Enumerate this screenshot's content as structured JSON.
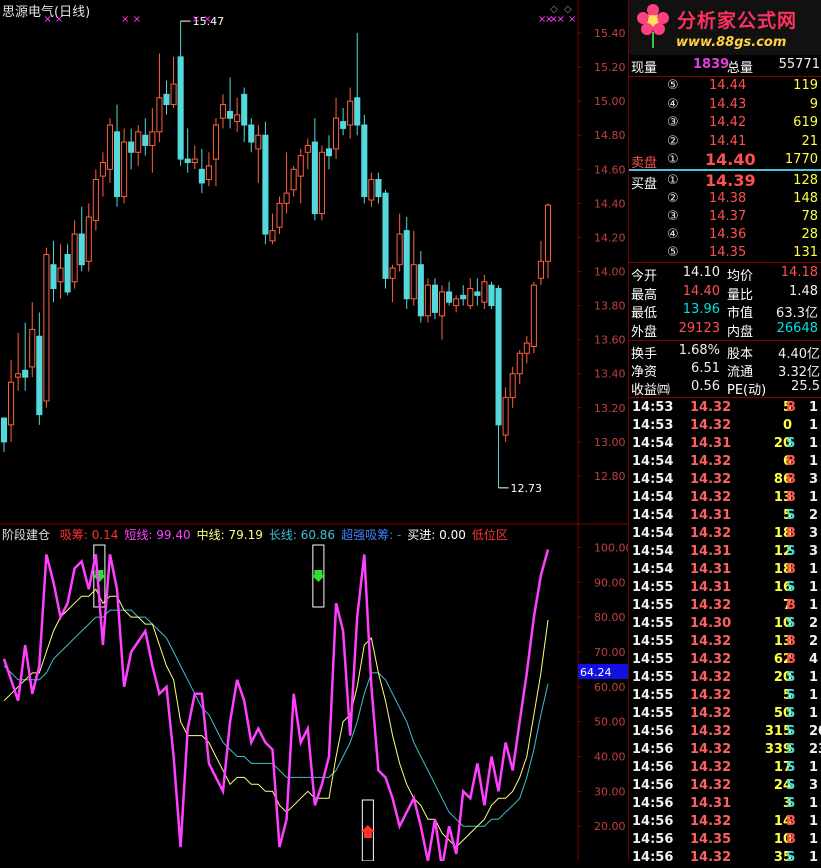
{
  "title": {
    "stock_name": "思源电气",
    "period": "(日线)"
  },
  "colors": {
    "up": "#ff6040",
    "up_body_fill": "#000000",
    "down": "#54d8dc",
    "grid": "#800000",
    "axis_text": "#c04040",
    "magenta": "#ff40ff",
    "yellow": "#ffff80",
    "cyan": "#40c0d0",
    "highlight_box": "#ffffff"
  },
  "chart_data": [
    {
      "type": "candlestick",
      "title": "思源电气(日线)",
      "ylim": [
        12.6,
        15.5
      ],
      "y_ticks": [
        "15.40",
        "15.20",
        "15.00",
        "14.80",
        "14.60",
        "14.40",
        "14.20",
        "14.00",
        "13.80",
        "13.60",
        "13.40",
        "13.20",
        "13.00",
        "12.80"
      ],
      "annotations": [
        {
          "label": "15.47",
          "kind": "high",
          "candle_index": 25
        },
        {
          "label": "12.73",
          "kind": "low",
          "candle_index": 70
        }
      ],
      "marker_rows": [
        {
          "label": "× ×",
          "candle_index": 5
        },
        {
          "label": "× ×",
          "candle_index": 16
        },
        {
          "label": "× ×",
          "candle_index": 26
        },
        {
          "label": "× ×",
          "candle_index": 75
        },
        {
          "label": "× × ×",
          "candle_index": 76
        }
      ],
      "corner_marks": [
        "◇",
        "◇"
      ],
      "candles": [
        {
          "o": 13.14,
          "h": 13.14,
          "l": 12.94,
          "c": 13.0
        },
        {
          "o": 13.1,
          "h": 13.48,
          "l": 13.0,
          "c": 13.35
        },
        {
          "o": 13.38,
          "h": 13.64,
          "l": 13.3,
          "c": 13.4
        },
        {
          "o": 13.42,
          "h": 13.7,
          "l": 13.3,
          "c": 13.38
        },
        {
          "o": 13.44,
          "h": 13.82,
          "l": 13.38,
          "c": 13.66
        },
        {
          "o": 13.62,
          "h": 13.76,
          "l": 13.1,
          "c": 13.16
        },
        {
          "o": 13.24,
          "h": 14.14,
          "l": 13.2,
          "c": 14.1
        },
        {
          "o": 14.04,
          "h": 14.18,
          "l": 13.82,
          "c": 13.9
        },
        {
          "o": 13.94,
          "h": 14.16,
          "l": 13.84,
          "c": 14.02
        },
        {
          "o": 14.1,
          "h": 14.16,
          "l": 13.86,
          "c": 13.88
        },
        {
          "o": 13.94,
          "h": 14.3,
          "l": 13.9,
          "c": 14.22
        },
        {
          "o": 14.22,
          "h": 14.38,
          "l": 14.0,
          "c": 14.04
        },
        {
          "o": 14.06,
          "h": 14.4,
          "l": 14.0,
          "c": 14.32
        },
        {
          "o": 14.3,
          "h": 14.6,
          "l": 14.24,
          "c": 14.54
        },
        {
          "o": 14.56,
          "h": 14.7,
          "l": 14.44,
          "c": 14.64
        },
        {
          "o": 14.6,
          "h": 14.9,
          "l": 14.52,
          "c": 14.86
        },
        {
          "o": 14.82,
          "h": 14.98,
          "l": 14.38,
          "c": 14.44
        },
        {
          "o": 14.44,
          "h": 14.84,
          "l": 14.4,
          "c": 14.76
        },
        {
          "o": 14.76,
          "h": 14.84,
          "l": 14.6,
          "c": 14.7
        },
        {
          "o": 14.7,
          "h": 14.86,
          "l": 14.62,
          "c": 14.82
        },
        {
          "o": 14.8,
          "h": 14.9,
          "l": 14.68,
          "c": 14.74
        },
        {
          "o": 14.74,
          "h": 14.96,
          "l": 14.58,
          "c": 14.82
        },
        {
          "o": 14.82,
          "h": 15.28,
          "l": 14.76,
          "c": 15.02
        },
        {
          "o": 15.04,
          "h": 15.12,
          "l": 14.92,
          "c": 14.98
        },
        {
          "o": 14.98,
          "h": 15.26,
          "l": 14.96,
          "c": 15.1
        },
        {
          "o": 15.26,
          "h": 15.47,
          "l": 14.62,
          "c": 14.66
        },
        {
          "o": 14.66,
          "h": 14.84,
          "l": 14.58,
          "c": 14.64
        },
        {
          "o": 14.64,
          "h": 14.74,
          "l": 14.6,
          "c": 14.66
        },
        {
          "o": 14.6,
          "h": 14.72,
          "l": 14.46,
          "c": 14.52
        },
        {
          "o": 14.54,
          "h": 14.7,
          "l": 14.5,
          "c": 14.62
        },
        {
          "o": 14.66,
          "h": 14.9,
          "l": 14.5,
          "c": 14.86
        },
        {
          "o": 14.9,
          "h": 15.04,
          "l": 14.84,
          "c": 14.98
        },
        {
          "o": 14.94,
          "h": 15.14,
          "l": 14.84,
          "c": 14.9
        },
        {
          "o": 14.88,
          "h": 15.02,
          "l": 14.82,
          "c": 14.92
        },
        {
          "o": 15.04,
          "h": 15.08,
          "l": 14.76,
          "c": 14.86
        },
        {
          "o": 14.86,
          "h": 14.9,
          "l": 14.7,
          "c": 14.76
        },
        {
          "o": 14.72,
          "h": 14.86,
          "l": 14.52,
          "c": 14.8
        },
        {
          "o": 14.8,
          "h": 14.88,
          "l": 14.16,
          "c": 14.22
        },
        {
          "o": 14.18,
          "h": 14.34,
          "l": 14.16,
          "c": 14.24
        },
        {
          "o": 14.26,
          "h": 14.44,
          "l": 14.22,
          "c": 14.4
        },
        {
          "o": 14.4,
          "h": 14.7,
          "l": 14.34,
          "c": 14.46
        },
        {
          "o": 14.48,
          "h": 14.62,
          "l": 14.44,
          "c": 14.6
        },
        {
          "o": 14.56,
          "h": 14.72,
          "l": 14.4,
          "c": 14.68
        },
        {
          "o": 14.7,
          "h": 14.78,
          "l": 14.6,
          "c": 14.74
        },
        {
          "o": 14.76,
          "h": 14.9,
          "l": 14.3,
          "c": 14.34
        },
        {
          "o": 14.34,
          "h": 14.74,
          "l": 14.3,
          "c": 14.7
        },
        {
          "o": 14.72,
          "h": 14.8,
          "l": 14.6,
          "c": 14.68
        },
        {
          "o": 14.72,
          "h": 15.02,
          "l": 14.66,
          "c": 14.9
        },
        {
          "o": 14.88,
          "h": 14.96,
          "l": 14.8,
          "c": 14.84
        },
        {
          "o": 14.86,
          "h": 15.08,
          "l": 14.78,
          "c": 15.0
        },
        {
          "o": 15.02,
          "h": 15.4,
          "l": 14.8,
          "c": 14.86
        },
        {
          "o": 14.86,
          "h": 14.92,
          "l": 14.4,
          "c": 14.44
        },
        {
          "o": 14.42,
          "h": 14.58,
          "l": 14.38,
          "c": 14.54
        },
        {
          "o": 14.54,
          "h": 14.58,
          "l": 14.4,
          "c": 14.44
        },
        {
          "o": 14.46,
          "h": 14.48,
          "l": 13.9,
          "c": 13.96
        },
        {
          "o": 13.96,
          "h": 14.04,
          "l": 13.82,
          "c": 14.02
        },
        {
          "o": 14.04,
          "h": 14.34,
          "l": 14.0,
          "c": 14.22
        },
        {
          "o": 14.24,
          "h": 14.32,
          "l": 13.78,
          "c": 13.84
        },
        {
          "o": 13.84,
          "h": 14.24,
          "l": 13.8,
          "c": 14.04
        },
        {
          "o": 14.04,
          "h": 14.12,
          "l": 13.7,
          "c": 13.74
        },
        {
          "o": 13.74,
          "h": 13.96,
          "l": 13.7,
          "c": 13.92
        },
        {
          "o": 13.92,
          "h": 13.96,
          "l": 13.72,
          "c": 13.76
        },
        {
          "o": 13.74,
          "h": 13.92,
          "l": 13.6,
          "c": 13.88
        },
        {
          "o": 13.88,
          "h": 13.94,
          "l": 13.8,
          "c": 13.82
        },
        {
          "o": 13.8,
          "h": 13.86,
          "l": 13.76,
          "c": 13.84
        },
        {
          "o": 13.86,
          "h": 13.92,
          "l": 13.8,
          "c": 13.84
        },
        {
          "o": 13.8,
          "h": 13.96,
          "l": 13.78,
          "c": 13.9
        },
        {
          "o": 13.88,
          "h": 13.96,
          "l": 13.8,
          "c": 13.86
        },
        {
          "o": 13.82,
          "h": 13.98,
          "l": 13.78,
          "c": 13.94
        },
        {
          "o": 13.92,
          "h": 13.94,
          "l": 13.78,
          "c": 13.8
        },
        {
          "o": 13.9,
          "h": 13.92,
          "l": 12.73,
          "c": 13.1
        },
        {
          "o": 13.04,
          "h": 13.32,
          "l": 13.0,
          "c": 13.26
        },
        {
          "o": 13.26,
          "h": 13.44,
          "l": 13.2,
          "c": 13.4
        },
        {
          "o": 13.4,
          "h": 13.54,
          "l": 13.34,
          "c": 13.52
        },
        {
          "o": 13.52,
          "h": 13.62,
          "l": 13.46,
          "c": 13.58
        },
        {
          "o": 13.56,
          "h": 13.94,
          "l": 13.52,
          "c": 13.92
        },
        {
          "o": 13.96,
          "h": 14.18,
          "l": 13.92,
          "c": 14.06
        },
        {
          "o": 14.06,
          "h": 14.4,
          "l": 13.96,
          "c": 14.39
        }
      ]
    },
    {
      "type": "line",
      "title": "阶段建仓",
      "ylim": [
        10,
        105
      ],
      "y_ticks": [
        "100.00",
        "90.00",
        "80.00",
        "70.00",
        "60.00",
        "50.00",
        "40.00",
        "30.00",
        "20.00"
      ],
      "current_value_label": "64.24",
      "legend": [
        {
          "name": "吸筹",
          "value": "0.14",
          "color": "#ff3030"
        },
        {
          "name": "短线",
          "value": "99.40",
          "color": "#ff40ff"
        },
        {
          "name": "中线",
          "value": "79.19",
          "color": "#ffff80"
        },
        {
          "name": "长线",
          "value": "60.86",
          "color": "#40c0d0"
        },
        {
          "name": "超强吸筹",
          "value": "-",
          "color": "#4080ff"
        },
        {
          "name": "买进",
          "value": "0.00",
          "color": "#ffffff"
        },
        {
          "name": "低位区",
          "value": "",
          "color": "#ff3030"
        }
      ],
      "series": [
        {
          "name": "短线",
          "color": "#ff40ff",
          "values": [
            68,
            62,
            56,
            72,
            58,
            66,
            98,
            90,
            80,
            84,
            94,
            96,
            88,
            98,
            72,
            98,
            88,
            60,
            70,
            73,
            76,
            66,
            58,
            60,
            40,
            14,
            48,
            58,
            58,
            38,
            34,
            30,
            50,
            62,
            56,
            44,
            48,
            44,
            42,
            14,
            22,
            58,
            44,
            48,
            26,
            32,
            40,
            84,
            76,
            46,
            80,
            98,
            60,
            36,
            34,
            28,
            20,
            24,
            28,
            20,
            10,
            22,
            8,
            20,
            12,
            30,
            28,
            38,
            26,
            40,
            30,
            44,
            36,
            50,
            64,
            80,
            92,
            99.4
          ]
        },
        {
          "name": "中线",
          "color": "#ffff80",
          "values": [
            56,
            58,
            60,
            62,
            64,
            64,
            70,
            76,
            80,
            82,
            84,
            86,
            86,
            88,
            84,
            86,
            86,
            82,
            80,
            80,
            78,
            78,
            72,
            66,
            62,
            50,
            46,
            46,
            46,
            44,
            40,
            36,
            32,
            34,
            34,
            32,
            32,
            30,
            30,
            26,
            24,
            26,
            28,
            30,
            28,
            28,
            28,
            40,
            50,
            52,
            60,
            72,
            74,
            64,
            56,
            46,
            38,
            32,
            28,
            26,
            22,
            22,
            18,
            16,
            14,
            16,
            18,
            20,
            22,
            26,
            28,
            28,
            30,
            34,
            40,
            52,
            64,
            79.2
          ]
        },
        {
          "name": "长线",
          "color": "#40c0d0",
          "values": [
            66,
            64,
            62,
            62,
            62,
            62,
            64,
            68,
            70,
            72,
            74,
            76,
            78,
            80,
            80,
            82,
            82,
            82,
            82,
            80,
            80,
            78,
            76,
            74,
            70,
            66,
            62,
            58,
            54,
            52,
            48,
            44,
            42,
            40,
            40,
            38,
            38,
            38,
            38,
            36,
            34,
            34,
            34,
            34,
            34,
            34,
            34,
            36,
            40,
            44,
            50,
            58,
            64,
            64,
            62,
            58,
            54,
            50,
            44,
            40,
            36,
            32,
            28,
            24,
            22,
            20,
            20,
            20,
            20,
            22,
            22,
            24,
            26,
            28,
            34,
            42,
            52,
            60.9
          ]
        }
      ],
      "signal_boxes": [
        {
          "start_index": 13,
          "end_index": 14,
          "arrow": "down"
        },
        {
          "start_index": 44,
          "end_index": 45,
          "arrow": "down"
        },
        {
          "start_index": 51,
          "end_index": 52,
          "arrow": "up"
        }
      ]
    }
  ],
  "quote": {
    "labels": {
      "current_vol": "现量",
      "total_vol": "总量",
      "sell_panel": "卖盘",
      "buy_panel": "买盘",
      "today_open": "今开",
      "avg_price": "均价",
      "high": "最高",
      "vol_ratio": "量比",
      "low": "最低",
      "market_cap": "市值",
      "outer": "外盘",
      "inner": "内盘",
      "turnover": "换手",
      "share_capital": "股本",
      "net_asset": "净资",
      "float": "流通",
      "eps": "收益㈣",
      "pe": "PE(动)"
    },
    "current_vol": "1839",
    "total_vol": "55771",
    "asks": [
      {
        "lvl": "⑤",
        "price": "14.44",
        "vol": "119"
      },
      {
        "lvl": "④",
        "price": "14.43",
        "vol": "9"
      },
      {
        "lvl": "③",
        "price": "14.42",
        "vol": "619"
      },
      {
        "lvl": "②",
        "price": "14.41",
        "vol": "21"
      },
      {
        "lvl": "①",
        "price": "14.40",
        "vol": "1770"
      }
    ],
    "bids": [
      {
        "lvl": "①",
        "price": "14.39",
        "vol": "128"
      },
      {
        "lvl": "②",
        "price": "14.38",
        "vol": "148"
      },
      {
        "lvl": "③",
        "price": "14.37",
        "vol": "78"
      },
      {
        "lvl": "④",
        "price": "14.36",
        "vol": "28"
      },
      {
        "lvl": "⑤",
        "price": "14.35",
        "vol": "131"
      }
    ],
    "today_open": "14.10",
    "avg_price": "14.18",
    "high": "14.40",
    "vol_ratio": "1.48",
    "low": "13.96",
    "market_cap": "63.3亿",
    "outer": "29123",
    "inner": "26648",
    "turnover": "1.68%",
    "share_capital": "4.40亿",
    "net_asset": "6.51",
    "float": "3.32亿",
    "eps": "0.56",
    "pe": "25.5"
  },
  "trades": [
    {
      "t": "14:53",
      "p": "14.32",
      "v": "5",
      "bs": "B",
      "n": "1"
    },
    {
      "t": "14:53",
      "p": "14.32",
      "v": "0",
      "bs": "",
      "n": "1"
    },
    {
      "t": "14:54",
      "p": "14.31",
      "v": "20",
      "bs": "S",
      "n": "1"
    },
    {
      "t": "14:54",
      "p": "14.32",
      "v": "6",
      "bs": "B",
      "n": "1"
    },
    {
      "t": "14:54",
      "p": "14.32",
      "v": "86",
      "bs": "B",
      "n": "3"
    },
    {
      "t": "14:54",
      "p": "14.32",
      "v": "13",
      "bs": "B",
      "n": "1"
    },
    {
      "t": "14:54",
      "p": "14.31",
      "v": "5",
      "bs": "S",
      "n": "2"
    },
    {
      "t": "14:54",
      "p": "14.32",
      "v": "18",
      "bs": "B",
      "n": "3"
    },
    {
      "t": "14:54",
      "p": "14.31",
      "v": "12",
      "bs": "S",
      "n": "3"
    },
    {
      "t": "14:54",
      "p": "14.31",
      "v": "18",
      "bs": "B",
      "n": "1"
    },
    {
      "t": "14:55",
      "p": "14.31",
      "v": "16",
      "bs": "S",
      "n": "1"
    },
    {
      "t": "14:55",
      "p": "14.32",
      "v": "7",
      "bs": "B",
      "n": "1"
    },
    {
      "t": "14:55",
      "p": "14.30",
      "v": "10",
      "bs": "S",
      "n": "2"
    },
    {
      "t": "14:55",
      "p": "14.32",
      "v": "13",
      "bs": "B",
      "n": "2"
    },
    {
      "t": "14:55",
      "p": "14.32",
      "v": "62",
      "bs": "B",
      "n": "4"
    },
    {
      "t": "14:55",
      "p": "14.32",
      "v": "20",
      "bs": "S",
      "n": "1"
    },
    {
      "t": "14:55",
      "p": "14.32",
      "v": "5",
      "bs": "S",
      "n": "1"
    },
    {
      "t": "14:55",
      "p": "14.32",
      "v": "50",
      "bs": "S",
      "n": "1"
    },
    {
      "t": "14:56",
      "p": "14.32",
      "v": "315",
      "bs": "S",
      "n": "20"
    },
    {
      "t": "14:56",
      "p": "14.32",
      "v": "339",
      "bs": "S",
      "n": "23"
    },
    {
      "t": "14:56",
      "p": "14.32",
      "v": "17",
      "bs": "S",
      "n": "1"
    },
    {
      "t": "14:56",
      "p": "14.32",
      "v": "24",
      "bs": "S",
      "n": "3"
    },
    {
      "t": "14:56",
      "p": "14.31",
      "v": "3",
      "bs": "S",
      "n": "1"
    },
    {
      "t": "14:56",
      "p": "14.32",
      "v": "14",
      "bs": "B",
      "n": "1"
    },
    {
      "t": "14:56",
      "p": "14.35",
      "v": "10",
      "bs": "B",
      "n": "1"
    },
    {
      "t": "14:56",
      "p": "14.32",
      "v": "35",
      "bs": "S",
      "n": "1"
    }
  ],
  "logo": {
    "name": "分析家公式网",
    "url": "www.88gs.com"
  }
}
